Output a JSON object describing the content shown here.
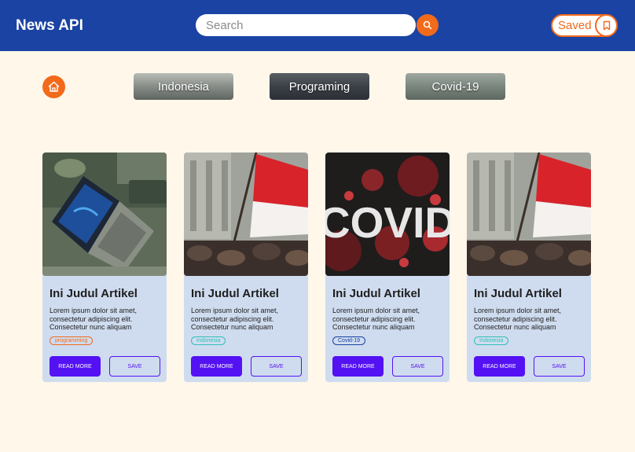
{
  "header": {
    "brand": "News API",
    "search_placeholder": "Search",
    "saved_label": "Saved"
  },
  "categories": [
    {
      "label": "Indonesia"
    },
    {
      "label": "Programing"
    },
    {
      "label": "Covid-19"
    }
  ],
  "cards": [
    {
      "title": "Ini Judul Artikel",
      "description": "Lorem ipsum dolor sit amet, consectetur adipiscing elit. Consectetur nunc aliquam",
      "tag": "programming",
      "read_label": "READ MORE",
      "save_label": "SAVE",
      "image": "laptop-image"
    },
    {
      "title": "Ini Judul Artikel",
      "description": "Lorem ipsum dolor sit amet, consectetur adipiscing elit. Consectetur nunc aliquam",
      "tag": "Indonesia",
      "read_label": "READ MORE",
      "save_label": "SAVE",
      "image": "indonesia-flag-image"
    },
    {
      "title": "Ini Judul Artikel",
      "description": "Lorem ipsum dolor sit amet, consectetur adipiscing elit. Consectetur nunc aliquam",
      "tag": "Covid-19",
      "read_label": "READ MORE",
      "save_label": "SAVE",
      "image": "covid-image",
      "image_text": "COVID"
    },
    {
      "title": "Ini Judul Artikel",
      "description": "Lorem ipsum dolor sit amet, consectetur adipiscing elit. Consectetur nunc aliquam",
      "tag": "Indonesia",
      "read_label": "READ MORE",
      "save_label": "SAVE",
      "image": "indonesia-flag-image"
    }
  ],
  "colors": {
    "header_bg": "#1a43a3",
    "accent": "#f26a1b",
    "page_bg": "#fff7ea",
    "card_bg": "#cfdcef",
    "button_primary": "#5411f3"
  }
}
